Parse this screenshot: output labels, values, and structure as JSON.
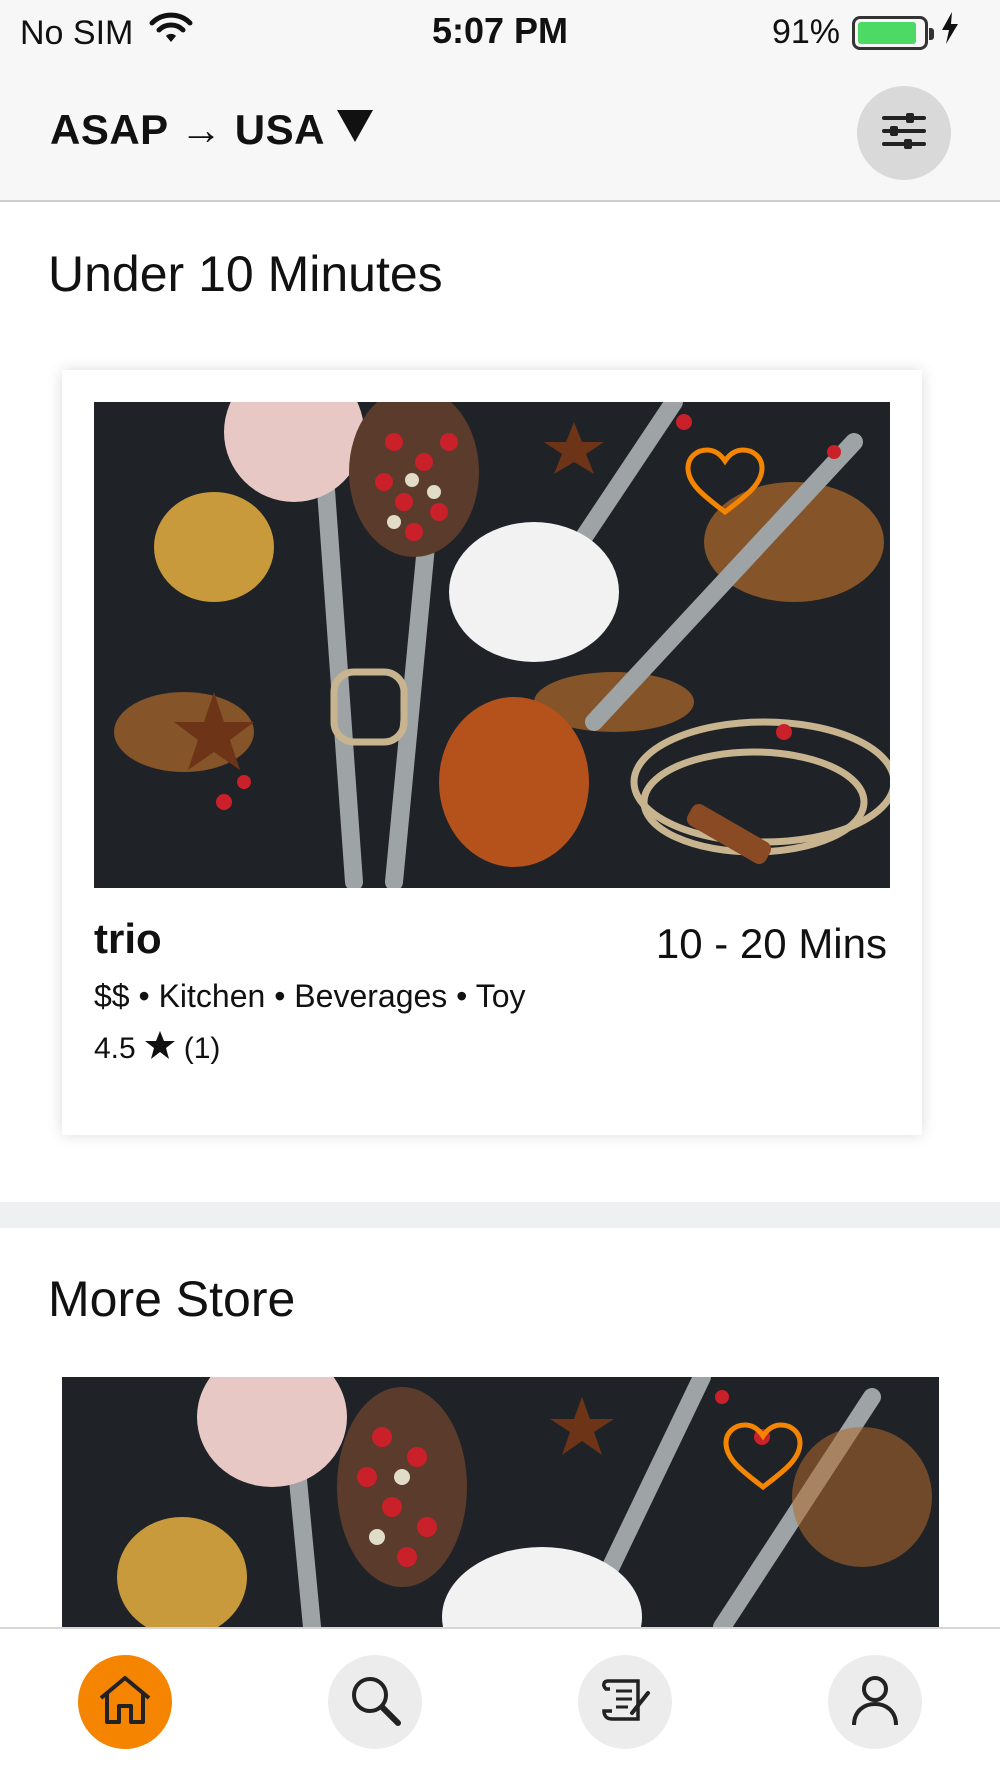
{
  "status_bar": {
    "carrier": "No SIM",
    "time": "5:07 PM",
    "battery_percent": "91%",
    "battery_level": 0.91
  },
  "header": {
    "location_label": "ASAP → USA",
    "location_dropdown_icon": "caret-down-icon",
    "filter_icon": "sliders-icon"
  },
  "sections": {
    "under10": {
      "title": "Under 10 Minutes",
      "store": {
        "name": "trio",
        "delivery_time": "10 - 20 Mins",
        "tags": "$$ • Kitchen • Beverages • Toy",
        "rating": "4.5",
        "rating_icon": "star-icon",
        "review_count": "(1)"
      }
    },
    "more": {
      "title": "More Store"
    }
  },
  "tabs": [
    {
      "name": "home",
      "icon": "home-icon",
      "active": true
    },
    {
      "name": "search",
      "icon": "search-icon",
      "active": false
    },
    {
      "name": "orders",
      "icon": "scroll-icon",
      "active": false
    },
    {
      "name": "account",
      "icon": "user-icon",
      "active": false
    }
  ],
  "colors": {
    "accent": "#f58500",
    "heart": "#f58500"
  }
}
